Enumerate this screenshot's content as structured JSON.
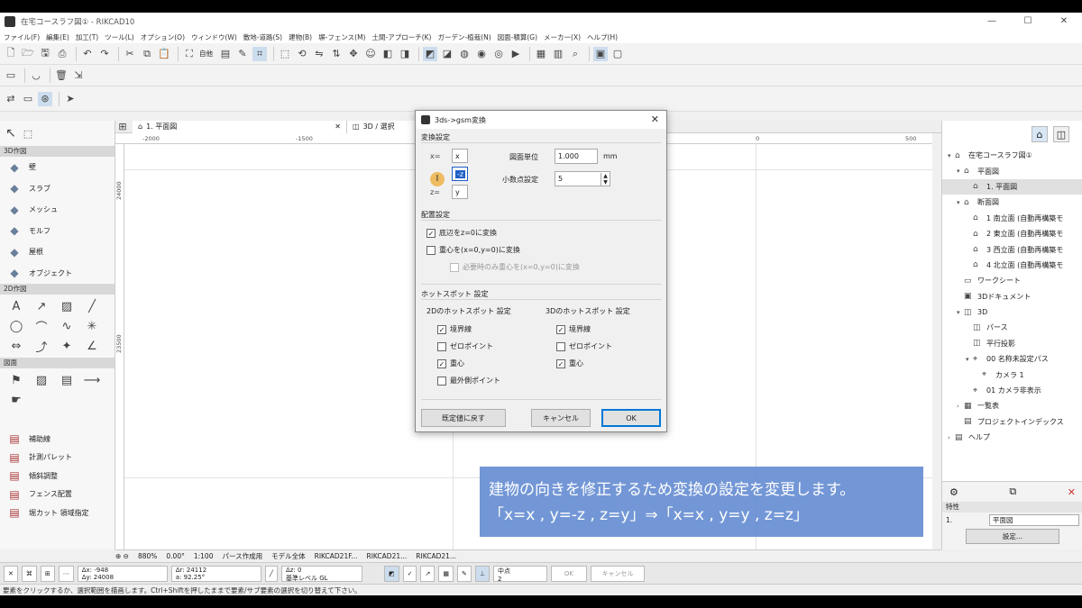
{
  "window": {
    "title": "在宅コースラフ図① - RIKCAD10",
    "minimize": "—",
    "maximize": "☐",
    "close": "✕"
  },
  "menu": [
    "ファイル(F)",
    "編集(E)",
    "加工(T)",
    "ツール(L)",
    "オプション(O)",
    "ウィンドウ(W)",
    "敷地-道路(S)",
    "建物(B)",
    "塀-フェンス(M)",
    "土間-アプローチ(K)",
    "ガーデン-植栽(N)",
    "図面-積算(G)",
    "メーカー(X)",
    "ヘルプ(H)"
  ],
  "toolbar1": {
    "floor_label": "自他"
  },
  "toolbar3": {},
  "left_panel": {
    "section_3d": "3D作図",
    "items_3d": [
      {
        "label": "壁",
        "icon": "wall-icon"
      },
      {
        "label": "スラブ",
        "icon": "slab-icon"
      },
      {
        "label": "メッシュ",
        "icon": "mesh-icon"
      },
      {
        "label": "モルフ",
        "icon": "morph-icon"
      },
      {
        "label": "屋根",
        "icon": "roof-icon"
      },
      {
        "label": "オブジェクト",
        "icon": "object-icon"
      }
    ],
    "section_2d": "2D作図",
    "section_drawing": "図面",
    "tools": [
      {
        "label": "補助線",
        "icon": "guide-line-icon"
      },
      {
        "label": "計測パレット",
        "icon": "measure-icon"
      },
      {
        "label": "傾斜調整",
        "icon": "slope-icon"
      },
      {
        "label": "フェンス配置",
        "icon": "fence-icon"
      },
      {
        "label": "堀カット 領域指定",
        "icon": "cut-icon"
      }
    ]
  },
  "canvas_tabs": [
    {
      "label": "1. 平面図"
    },
    {
      "label": "3D / 選択"
    }
  ],
  "ruler": {
    "labels": [
      "-2000",
      "-1500",
      "0",
      "500"
    ]
  },
  "vruler": {
    "labels": [
      "24000",
      "23500"
    ]
  },
  "right_panel": {
    "tree": [
      {
        "label": "在宅コースラフ図①",
        "level": 0,
        "twisty": "▾",
        "icon": "⌂"
      },
      {
        "label": "平面図",
        "level": 1,
        "twisty": "▾",
        "icon": "⌂"
      },
      {
        "label": "1. 平面図",
        "level": 2,
        "twisty": "",
        "icon": "⌂",
        "selected": true
      },
      {
        "label": "断面図",
        "level": 1,
        "twisty": "▾",
        "icon": "⌂"
      },
      {
        "label": "1 南立面 (自動再構築モ",
        "level": 2,
        "twisty": "",
        "icon": "⌂"
      },
      {
        "label": "2 東立面 (自動再構築モ",
        "level": 2,
        "twisty": "",
        "icon": "⌂"
      },
      {
        "label": "3 西立面 (自動再構築モ",
        "level": 2,
        "twisty": "",
        "icon": "⌂"
      },
      {
        "label": "4 北立面 (自動再構築モ",
        "level": 2,
        "twisty": "",
        "icon": "⌂"
      },
      {
        "label": "ワークシート",
        "level": 1,
        "twisty": "",
        "icon": "▭"
      },
      {
        "label": "3Dドキュメント",
        "level": 1,
        "twisty": "",
        "icon": "▣"
      },
      {
        "label": "3D",
        "level": 1,
        "twisty": "▾",
        "icon": "◫"
      },
      {
        "label": "パース",
        "level": 2,
        "twisty": "",
        "icon": "◫"
      },
      {
        "label": "平行投影",
        "level": 2,
        "twisty": "",
        "icon": "◫"
      },
      {
        "label": "00 名称未設定パス",
        "level": 2,
        "twisty": "▾",
        "icon": "⌖"
      },
      {
        "label": "カメラ 1",
        "level": 3,
        "twisty": "",
        "icon": "⌖"
      },
      {
        "label": "01 カメラ非表示",
        "level": 2,
        "twisty": "",
        "icon": "⌖"
      },
      {
        "label": "一覧表",
        "level": 1,
        "twisty": "›",
        "icon": "▦"
      },
      {
        "label": "プロジェクトインデックス",
        "level": 1,
        "twisty": "",
        "icon": "▤"
      },
      {
        "label": "ヘルプ",
        "level": 0,
        "twisty": "›",
        "icon": "▤"
      }
    ],
    "props_title": "特性",
    "props_num": "1.",
    "props_value": "平面図",
    "settings_btn": "設定..."
  },
  "status_row": {
    "zoom": "880%",
    "angle": "0.00°",
    "scale": "1:100",
    "layer_set": "パース作成用",
    "model": "モデル全体",
    "view1": "RIKCAD21F...",
    "view2": "RIKCAD21...",
    "view3": "RIKCAD21..."
  },
  "info_bar": {
    "dx": "Δx: -948",
    "dy": "Δy: 24008",
    "dr": "Δr: 24112",
    "da": "a: 92.25°",
    "dz": "Δz: 0",
    "ref": "基準レベル GL",
    "mid": "中点",
    "num": "2",
    "ok": "OK",
    "cancel": "キャンセル"
  },
  "status_line": "要素をクリックするか、選択範囲を描画します。Ctrl+Shiftを押したままで要素/サブ要素の選択を切り替えて下さい。",
  "dialog": {
    "title": "3ds->gsm変換",
    "section_convert": "変換設定",
    "x_label": "x=",
    "x_value": "x",
    "y_value": "-z",
    "z_label": "z=",
    "z_value": "y",
    "unit_label": "図面単位",
    "unit_value": "1.000",
    "unit_suffix": "mm",
    "decimal_label": "小数点設定",
    "decimal_value": "5",
    "section_place": "配置設定",
    "place_opts": [
      {
        "label": "底辺をz=0に変換",
        "checked": true,
        "disabled": false
      },
      {
        "label": "重心を(x=0,y=0)に変換",
        "checked": false,
        "disabled": false
      },
      {
        "label": "必要時のみ重心を(x=0,y=0)に変換",
        "checked": false,
        "disabled": true
      }
    ],
    "section_hotspot": "ホットスポット 設定",
    "hs2d_head": "2Dのホットスポット 設定",
    "hs3d_head": "3Dのホットスポット 設定",
    "hs2d": [
      {
        "label": "境界線",
        "checked": true
      },
      {
        "label": "ゼロポイント",
        "checked": false
      },
      {
        "label": "重心",
        "checked": true
      },
      {
        "label": "最外側ポイント",
        "checked": false
      }
    ],
    "hs3d": [
      {
        "label": "境界線",
        "checked": true
      },
      {
        "label": "ゼロポイント",
        "checked": false
      },
      {
        "label": "重心",
        "checked": true
      }
    ],
    "btn_default": "既定値に戻す",
    "btn_cancel": "キャンセル",
    "btn_ok": "OK"
  },
  "caption": {
    "line1": "建物の向きを修正するため変換の設定を変更します。",
    "line2": "「x=x , y=-z , z=y」⇒「x=x , y=y , z=z」"
  }
}
